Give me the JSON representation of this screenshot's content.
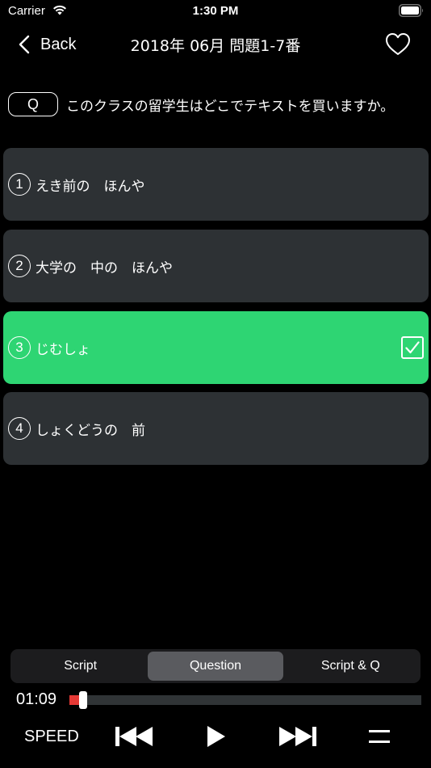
{
  "status_bar": {
    "carrier": "Carrier",
    "time": "1:30 PM"
  },
  "nav": {
    "back_label": "Back",
    "title": "2018年 06月 問題1-7番"
  },
  "question": {
    "badge": "Q",
    "text": "このクラスの留学生はどこでテキストを買いますか。"
  },
  "options": [
    {
      "number": "1",
      "label": "えき前の　ほんや",
      "selected": false
    },
    {
      "number": "2",
      "label": "大学の　中の　ほんや",
      "selected": false
    },
    {
      "number": "3",
      "label": "じむしょ",
      "selected": true
    },
    {
      "number": "4",
      "label": "しょくどうの　前",
      "selected": false
    }
  ],
  "segment": {
    "items": [
      "Script",
      "Question",
      "Script & Q"
    ],
    "active_index": 1
  },
  "player": {
    "time": "01:09",
    "progress": 0.03,
    "speed_label": "SPEED"
  },
  "colors": {
    "background": "#000000",
    "option_bg": "#2d3134",
    "selected_bg": "#2ed573",
    "progress_fill": "#e53935",
    "segment_bg": "#1c1c1e",
    "segment_active": "#5a5b5f"
  },
  "icons": {
    "wifi": "wifi-icon",
    "battery": "battery-icon",
    "back": "chevron-left-icon",
    "favorite": "heart-icon",
    "check": "checkbox-checked-icon",
    "previous": "skip-back-icon",
    "play": "play-icon",
    "next": "skip-forward-icon",
    "menu": "menu-icon"
  }
}
